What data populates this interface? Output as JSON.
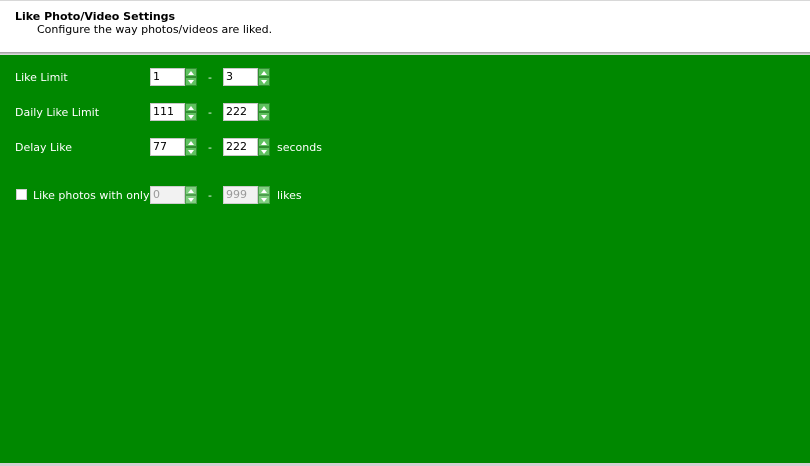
{
  "header": {
    "title": "Like Photo/Video Settings",
    "subtitle": "Configure the way photos/videos are liked."
  },
  "colors": {
    "panel_background": "#008800",
    "spinner_button": "#5fc15f",
    "text": "#ffffff"
  },
  "rows": {
    "like_limit": {
      "label": "Like Limit",
      "min": "1",
      "max": "3",
      "separator": "-"
    },
    "daily_like_limit": {
      "label": "Daily Like Limit",
      "min": "111",
      "max": "222",
      "separator": "-"
    },
    "delay_like": {
      "label": "Delay Like",
      "min": "77",
      "max": "222",
      "separator": "-",
      "unit": "seconds"
    },
    "like_photos_with_only": {
      "label": "Like photos with only",
      "checked": false,
      "min": "0",
      "max": "999",
      "separator": "-",
      "unit": "likes",
      "inputs_enabled": false
    }
  }
}
